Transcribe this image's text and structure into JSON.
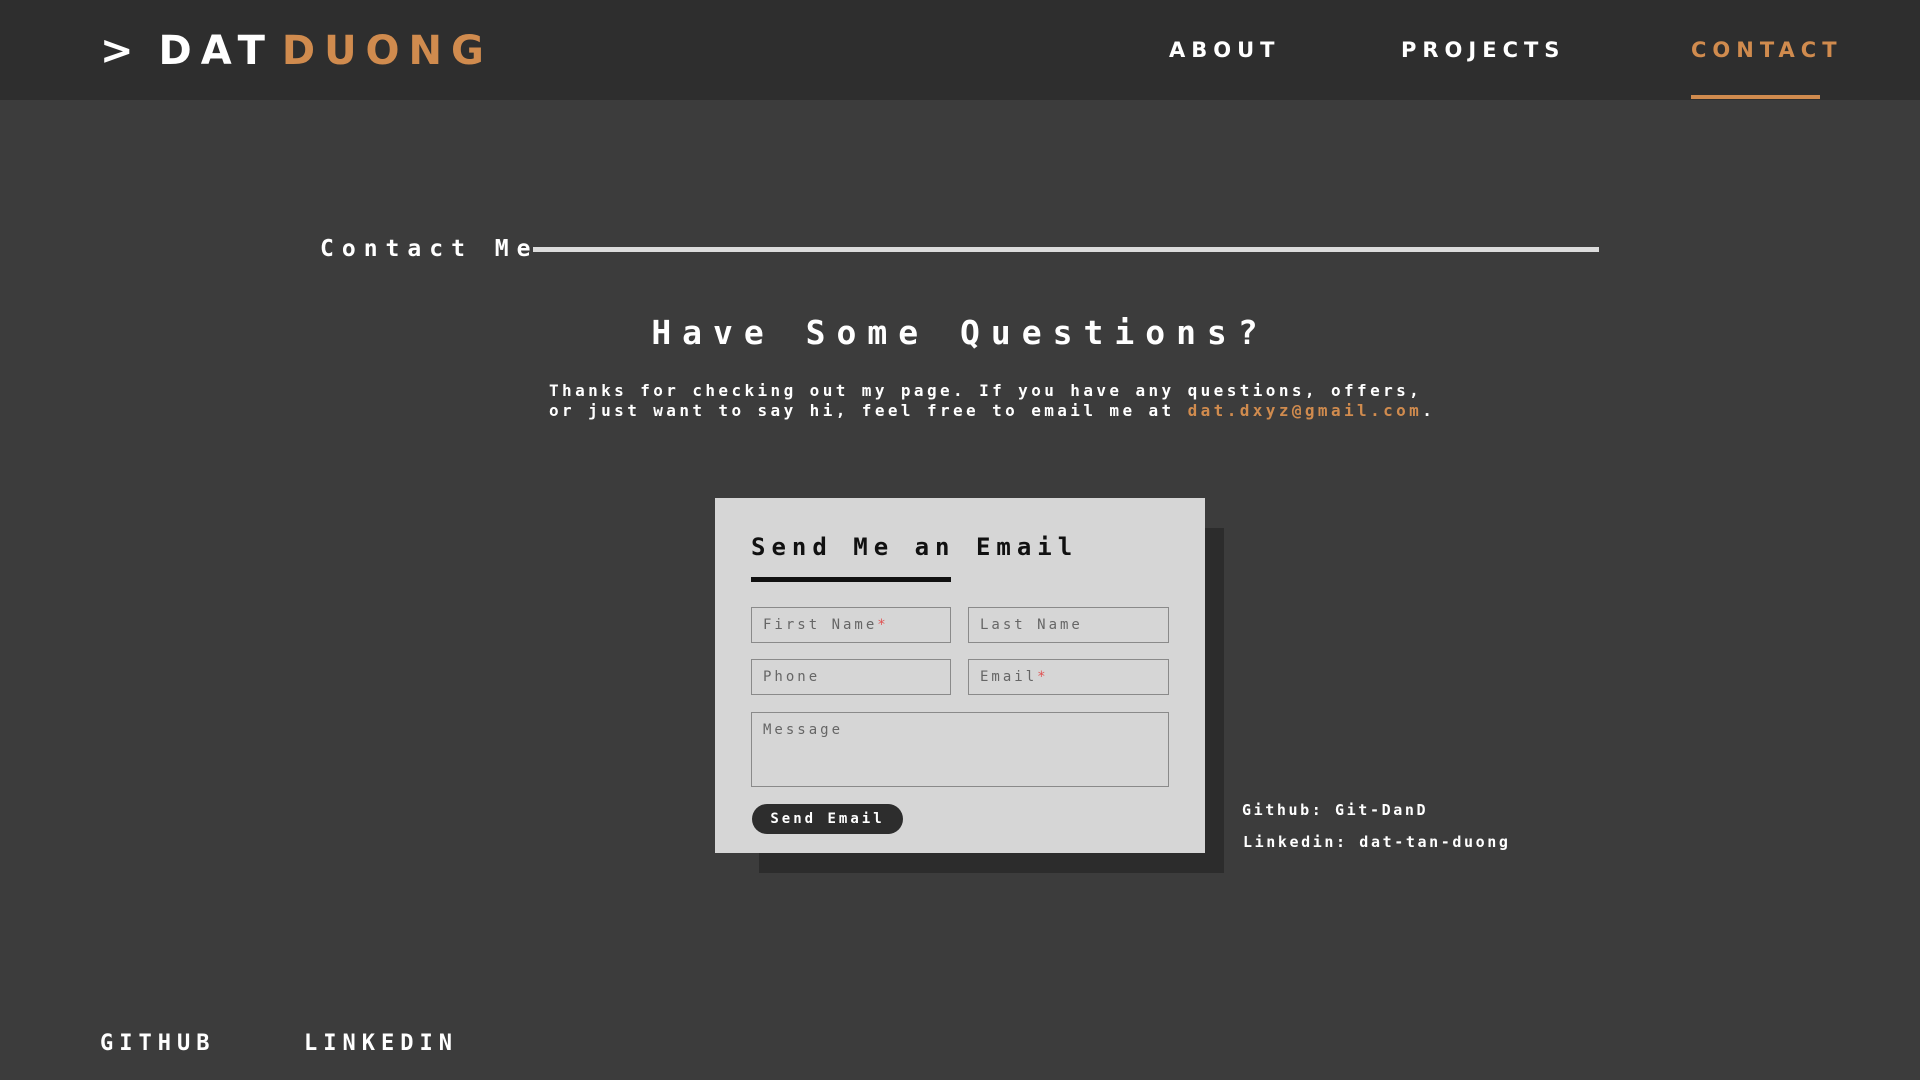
{
  "header": {
    "logo": {
      "prompt": ">",
      "first": "DAT",
      "last": "DUONG"
    },
    "nav": [
      {
        "label": "ABOUT"
      },
      {
        "label": "PROJECTS"
      },
      {
        "label": "CONTACT",
        "active": true
      }
    ]
  },
  "contact": {
    "section_title": "Contact Me",
    "headline": "Have Some Questions?",
    "intro_text": "Thanks for checking out my page. If you have any questions, offers, or just want to say hi, feel free to email me at ",
    "email": "dat.dxyz@gmail.com",
    "intro_end": "."
  },
  "form": {
    "title": "Send Me an Email",
    "fields": {
      "first_name": {
        "placeholder": "First Name",
        "required": "*"
      },
      "last_name": {
        "placeholder": "Last Name"
      },
      "phone": {
        "placeholder": "Phone"
      },
      "email": {
        "placeholder": "Email",
        "required": "*"
      },
      "message": {
        "placeholder": "Message"
      }
    },
    "submit_label": "Send Email"
  },
  "side_links": {
    "github": "Github: Git-DanD",
    "linkedin": "Linkedin: dat-tan-duong"
  },
  "footer": {
    "links": [
      "GITHUB",
      "LINKEDIN"
    ]
  },
  "colors": {
    "accent": "#d08b4e",
    "background": "#3c3c3c",
    "header_bg": "#2e2e2e",
    "card_bg": "#d6d6d6",
    "required": "#e05252"
  }
}
